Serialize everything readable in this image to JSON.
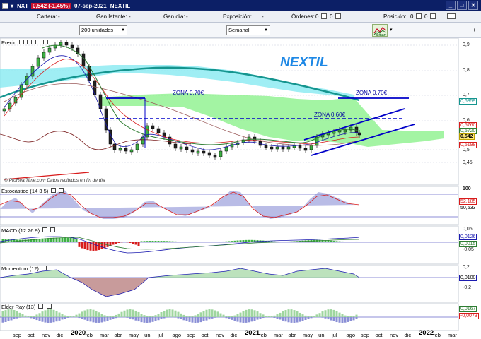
{
  "titlebar": {
    "symbol": "NXT",
    "quote": "0,542 (-1,45%)",
    "date": "07-sep-2021",
    "name": "NEXTIL"
  },
  "infobar": {
    "cartera_label": "Cartera:",
    "cartera_value": "-",
    "gan_latente_label": "Gan latente:",
    "gan_latente_value": "-",
    "gan_dia_label": "Gan día:",
    "gan_dia_value": "-",
    "exposicion_label": "Exposición:",
    "exposicion_value": "-",
    "ordenes_label": "Órdenes:",
    "ordenes_value_1": "0",
    "ordenes_value_2": "0",
    "posicion_label": "Posición:",
    "posicion_value_1": "0",
    "posicion_value_2": "0"
  },
  "toolbar": {
    "units_value": "200 unidades",
    "period_value": "Semanal",
    "tool_label": "Smart"
  },
  "price_panel": {
    "label": "Precio",
    "title_watermark": "NEXTIL",
    "zona_1": "ZONA 0,70€",
    "zona_2": "ZONA 0,70€",
    "zona_3": "ZONA 0,60€",
    "yaxis": [
      "0,9",
      "0,8",
      "0,7",
      "0,6",
      "0,5",
      "0,45"
    ],
    "tags": [
      "0,6859",
      "0,5760",
      "0,5720",
      "0,542",
      "0,5198"
    ],
    "watermark": "© ProRealTime.com  Datos recibidos en fin de día"
  },
  "stochastic": {
    "label": "Estocástico (14 3 5)",
    "y_top": "100",
    "tag_1": "52,185",
    "tag_2": "50,533"
  },
  "macd": {
    "label": "MACD (12 26 9)",
    "y_top": "0,05",
    "y_bottom": "-0,05",
    "tag_1": "0,0126",
    "tag_2": "0,0015"
  },
  "momentum": {
    "label": "Momentum (12)",
    "y_top": "0,2",
    "y_bottom": "-0,2",
    "tag_1": "0,0100"
  },
  "elder": {
    "label": "Elder Ray (13)",
    "tag_1": "0,0167",
    "tag_2": "-0,0073"
  },
  "xaxis": {
    "months": [
      "sep",
      "oct",
      "nov",
      "dic",
      "2020",
      "feb",
      "mar",
      "abr",
      "may",
      "jun",
      "jul",
      "ago",
      "sep",
      "oct",
      "nov",
      "dic",
      "2021",
      "feb",
      "mar",
      "abr",
      "may",
      "jun",
      "jul",
      "ago",
      "sep",
      "oct",
      "nov",
      "dic",
      "2022",
      "feb",
      "mar"
    ]
  },
  "colors": {
    "titlebar": "#0c1f66",
    "quote_bg": "#c8102e",
    "cloud": "#7cf07c",
    "cloud_bearish": "#7fe8f0",
    "long_ma": "#15958f",
    "channel": "#0000c8",
    "watermark_text": "#1e88e5"
  }
}
